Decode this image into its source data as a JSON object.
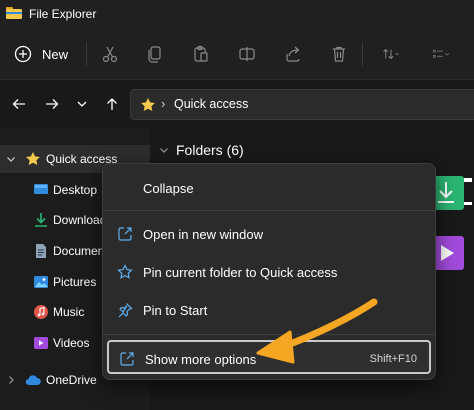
{
  "window": {
    "title": "File Explorer"
  },
  "toolbar": {
    "new_label": "New",
    "buttons": [
      "cut-icon",
      "copy-icon",
      "paste-icon",
      "rename-icon",
      "share-icon",
      "delete-icon",
      "sort-icon",
      "view-icon"
    ]
  },
  "address": {
    "path": "Quick access"
  },
  "sidebar": {
    "items": [
      {
        "label": "Quick access",
        "icon": "star-icon",
        "selected": true
      },
      {
        "label": "Desktop",
        "icon": "desktop-icon"
      },
      {
        "label": "Downloads",
        "icon": "download-icon"
      },
      {
        "label": "Documents",
        "icon": "documents-icon"
      },
      {
        "label": "Pictures",
        "icon": "pictures-icon"
      },
      {
        "label": "Music",
        "icon": "music-icon"
      },
      {
        "label": "Videos",
        "icon": "videos-icon"
      },
      {
        "label": "OneDrive",
        "icon": "cloud-icon"
      }
    ]
  },
  "content": {
    "folders_heading": "Folders (6)"
  },
  "context_menu": {
    "items": [
      {
        "label": "Collapse",
        "icon": ""
      },
      {
        "label": "Open in new window",
        "icon": "open-new-window-icon"
      },
      {
        "label": "Pin current folder to Quick access",
        "icon": "star-outline-icon"
      },
      {
        "label": "Pin to Start",
        "icon": "pin-icon"
      },
      {
        "label": "Show more options",
        "icon": "show-more-icon",
        "shortcut": "Shift+F10",
        "highlighted": true
      }
    ]
  },
  "colors": {
    "accent_arrow": "#f5a623",
    "folder_yellow": "#f2c94c",
    "downloads_green": "#2bb673",
    "videos_purple": "#a24bdc",
    "onedrive_blue": "#2f8ae0"
  }
}
